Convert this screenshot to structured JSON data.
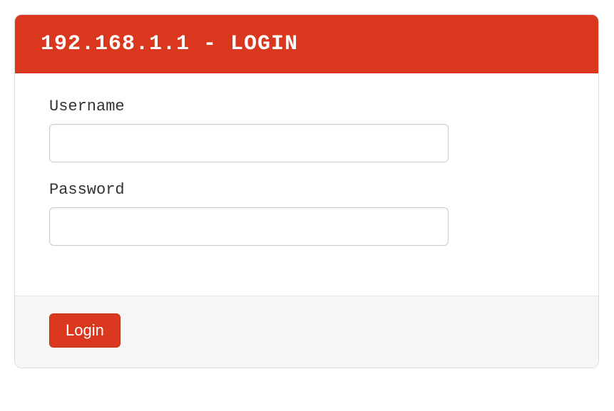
{
  "header": {
    "title": "192.168.1.1 - LOGIN"
  },
  "form": {
    "username": {
      "label": "Username",
      "value": ""
    },
    "password": {
      "label": "Password",
      "value": ""
    }
  },
  "footer": {
    "login_button_label": "Login"
  }
}
